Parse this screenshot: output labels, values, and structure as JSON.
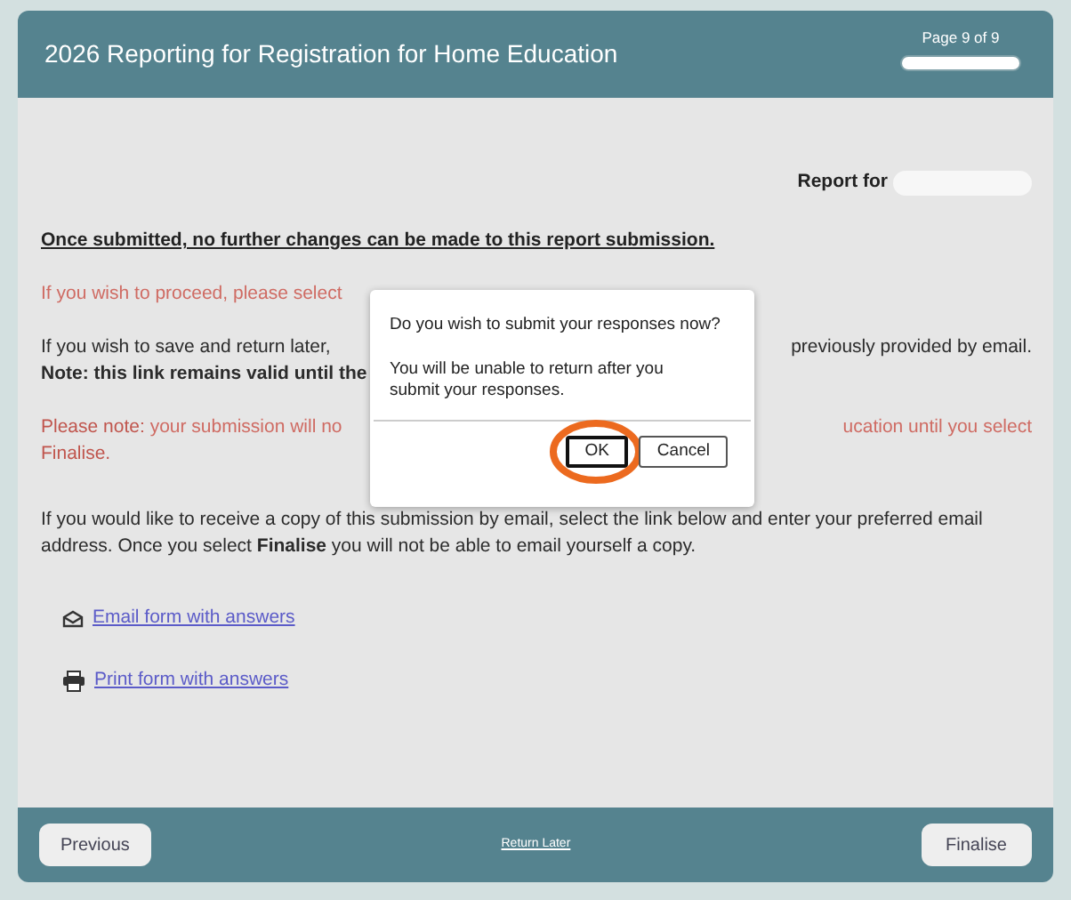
{
  "header": {
    "title": "2026 Reporting for Registration for Home Education",
    "page_label": "Page 9 of 9",
    "progress": {
      "level": 1
    }
  },
  "report_for": {
    "label": "Report for"
  },
  "warning": "Once submitted, no further changes can be made to this report submission.",
  "paragraphs": [
    {
      "kind": "split",
      "alert": true,
      "left": "If you wish to proceed, please select"
    },
    {
      "kind": "split",
      "alert": false,
      "left": "If you wish to save and return later,",
      "right": "previously provided by email.",
      "line2": "Note: this link remains valid until the"
    },
    {
      "kind": "split",
      "alert": true,
      "lead": "Please note:",
      "left": "your submission will no",
      "right": "ucation until you select",
      "line2": "Finalise."
    },
    {
      "kind": "full",
      "alert": false,
      "text": "If you would like to receive a copy of this submission by email, select the link below and enter your preferred email address. Once you select **Finalise** you will not be able to email yourself a copy."
    }
  ],
  "links": [
    {
      "kind": "email",
      "label": "Email form with answers"
    },
    {
      "kind": "print",
      "label": "Print form with answers"
    }
  ],
  "dialog": {
    "question": "Do you wish to submit your responses now?",
    "message": "You will be unable to return after you submit your responses.",
    "buttons": [
      {
        "label": "OK",
        "selected": true,
        "circled": true
      },
      {
        "label": "Cancel",
        "selected": false,
        "circled": false
      }
    ]
  },
  "footer": {
    "previous": "Previous",
    "return_later": "Return Later",
    "finalise": "Finalise"
  }
}
